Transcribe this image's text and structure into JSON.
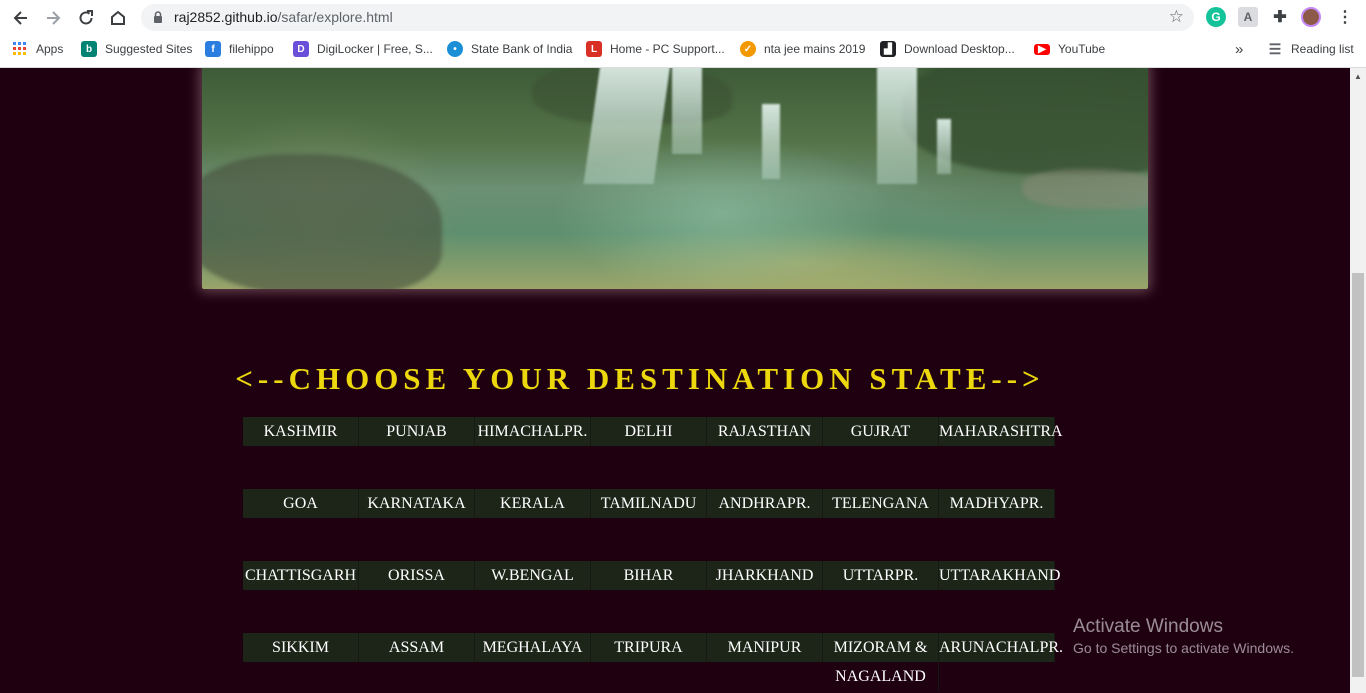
{
  "browser": {
    "url_host": "raj2852.github.io",
    "url_path": "/safar/explore.html",
    "bookmarks": [
      {
        "label": "Apps",
        "icon": "apps-grid-icon",
        "color": "#4285f4"
      },
      {
        "label": "Suggested Sites",
        "icon": "bing-icon",
        "color": "#008373"
      },
      {
        "label": "filehippo",
        "icon": "filehippo-icon",
        "color": "#2b7de0"
      },
      {
        "label": "DigiLocker | Free, S...",
        "icon": "digilocker-icon",
        "color": "#6a4fd8"
      },
      {
        "label": "State Bank of India",
        "icon": "sbi-icon",
        "color": "#1a8fd6"
      },
      {
        "label": "Home - PC Support...",
        "icon": "pc-support-icon",
        "color": "#d93025"
      },
      {
        "label": "nta jee mains 2019",
        "icon": "nta-icon",
        "color": "#f29900"
      },
      {
        "label": "Download Desktop...",
        "icon": "download-desktop-icon",
        "color": "#202124"
      },
      {
        "label": "YouTube",
        "icon": "youtube-icon",
        "color": "#ff0000"
      }
    ],
    "more_label": "»",
    "reading_list": "Reading list"
  },
  "page": {
    "heading": "<--CHOOSE YOUR DESTINATION STATE-->",
    "rows": [
      [
        "KASHMIR",
        "PUNJAB",
        "HIMACHALPR.",
        "DELHI",
        "RAJASTHAN",
        "GUJRAT",
        "MAHARASHTRA"
      ],
      [
        "GOA",
        "KARNATAKA",
        "KERALA",
        "TAMILNADU",
        "ANDHRAPR.",
        "TELENGANA",
        "MADHYAPR."
      ],
      [
        "CHATTISGARH",
        "ORISSA",
        "W.BENGAL",
        "BIHAR",
        "JHARKHAND",
        "UTTARPR.",
        "UTTARAKHAND"
      ],
      [
        "SIKKIM",
        "ASSAM",
        "MEGHALAYA",
        "TRIPURA",
        "MANIPUR",
        "MIZORAM & NAGALAND",
        "ARUNACHALPR."
      ]
    ]
  },
  "watermark": {
    "title": "Activate Windows",
    "subtitle": "Go to Settings to activate Windows."
  },
  "colors": {
    "background": "#1f0010",
    "heading": "#ecd80c",
    "cell_bg": "#1d2519"
  }
}
